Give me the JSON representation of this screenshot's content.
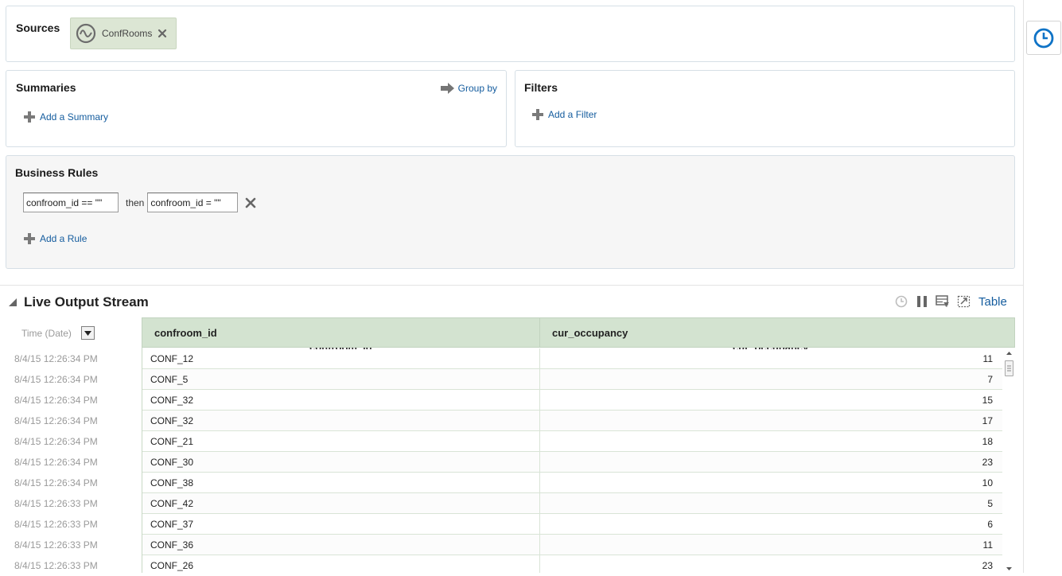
{
  "sources": {
    "title": "Sources",
    "chip_label": "ConfRooms"
  },
  "summaries": {
    "title": "Summaries",
    "group_by": "Group by",
    "add_label": "Add a Summary"
  },
  "filters": {
    "title": "Filters",
    "add_label": "Add a Filter"
  },
  "rules": {
    "title": "Business Rules",
    "condition_value": "confroom_id == \"\"",
    "then_label": "then",
    "action_value": "confroom_id = \"\"",
    "add_label": "Add a Rule"
  },
  "stream": {
    "title": "Live Output Stream",
    "view_label": "Table",
    "time_header": "Time (Date)",
    "columns": [
      "confroom_id",
      "cur_occupancy"
    ],
    "rows": [
      {
        "time": "8/4/15 12:26:34 PM",
        "confroom_id": "CONF_12",
        "cur_occupancy": "11"
      },
      {
        "time": "8/4/15 12:26:34 PM",
        "confroom_id": "CONF_5",
        "cur_occupancy": "7"
      },
      {
        "time": "8/4/15 12:26:34 PM",
        "confroom_id": "CONF_32",
        "cur_occupancy": "15"
      },
      {
        "time": "8/4/15 12:26:34 PM",
        "confroom_id": "CONF_32",
        "cur_occupancy": "17"
      },
      {
        "time": "8/4/15 12:26:34 PM",
        "confroom_id": "CONF_21",
        "cur_occupancy": "18"
      },
      {
        "time": "8/4/15 12:26:34 PM",
        "confroom_id": "CONF_30",
        "cur_occupancy": "23"
      },
      {
        "time": "8/4/15 12:26:34 PM",
        "confroom_id": "CONF_38",
        "cur_occupancy": "10"
      },
      {
        "time": "8/4/15 12:26:33 PM",
        "confroom_id": "CONF_42",
        "cur_occupancy": "5"
      },
      {
        "time": "8/4/15 12:26:33 PM",
        "confroom_id": "CONF_37",
        "cur_occupancy": "6"
      },
      {
        "time": "8/4/15 12:26:33 PM",
        "confroom_id": "CONF_36",
        "cur_occupancy": "11"
      },
      {
        "time": "8/4/15 12:26:33 PM",
        "confroom_id": "CONF_26",
        "cur_occupancy": "23"
      }
    ]
  },
  "icons": {
    "source_chip": "stream-wave-icon",
    "remove": "close-x-icon",
    "group_by": "arrow-right-icon",
    "add": "plus-icon",
    "side_tab": "clock-icon",
    "collapse": "triangle-collapse-icon",
    "toolbar": [
      "clock-icon",
      "pause-icon",
      "filter-table-icon",
      "fullscreen-icon"
    ]
  },
  "colors": {
    "link": "#145c9e",
    "chip_bg": "#dce6d4",
    "table_header_bg": "#d3e3d0",
    "rules_bg": "#f6f6f6",
    "muted_text": "#9a9a9a"
  }
}
